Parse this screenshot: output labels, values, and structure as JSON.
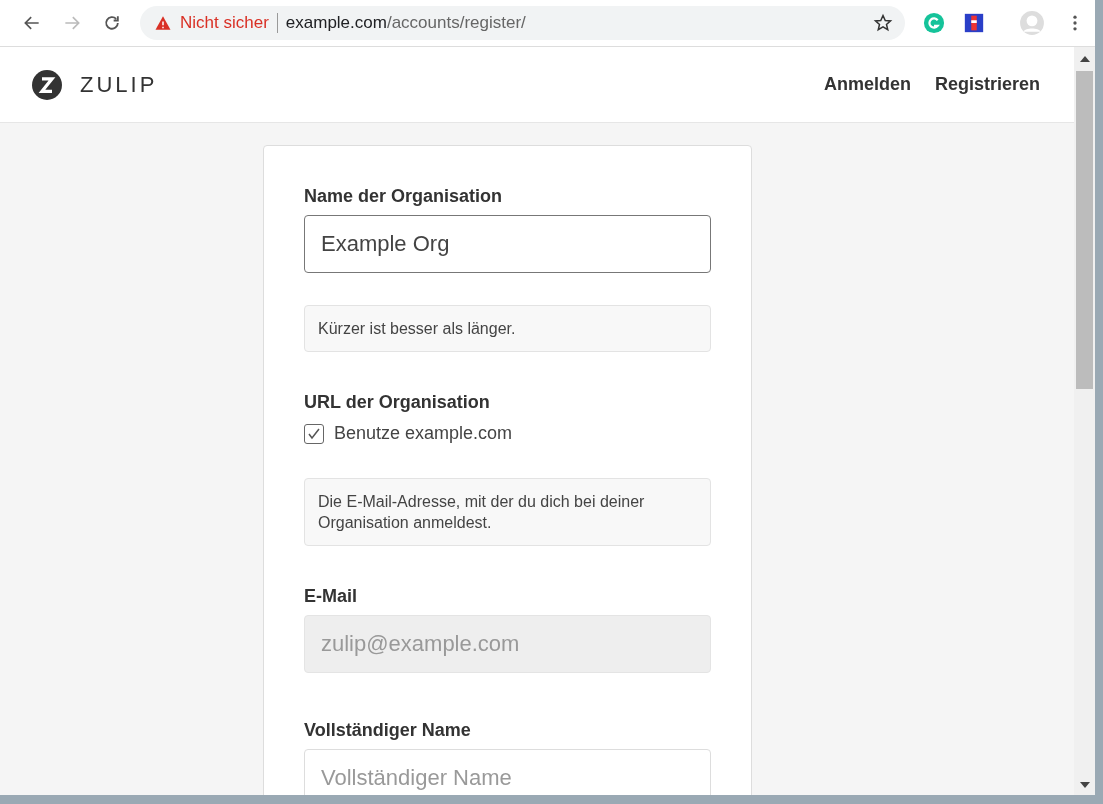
{
  "browser": {
    "warning": "Nicht sicher",
    "url_host": "example.com",
    "url_path": "/accounts/register/"
  },
  "header": {
    "logo_text": "ZULIP",
    "nav": [
      {
        "label": "Anmelden"
      },
      {
        "label": "Registrieren"
      }
    ]
  },
  "form": [
    {
      "kind": "text",
      "label": "Name der Organisation",
      "value": "Example Org",
      "disabled": false
    },
    {
      "kind": "hint",
      "text": "Kürzer ist besser als länger."
    },
    {
      "kind": "checkbox",
      "label": "URL der Organisation",
      "option": "Benutze example.com",
      "checked": true
    },
    {
      "kind": "hint",
      "text": "Die E-Mail-Adresse, mit der du dich bei deiner Organisation anmeldest."
    },
    {
      "kind": "text",
      "label": "E-Mail",
      "placeholder": "zulip@example.com",
      "disabled": true
    },
    {
      "kind": "text",
      "label": "Vollständiger Name",
      "placeholder": "Vollständiger Name",
      "disabled": false
    }
  ]
}
